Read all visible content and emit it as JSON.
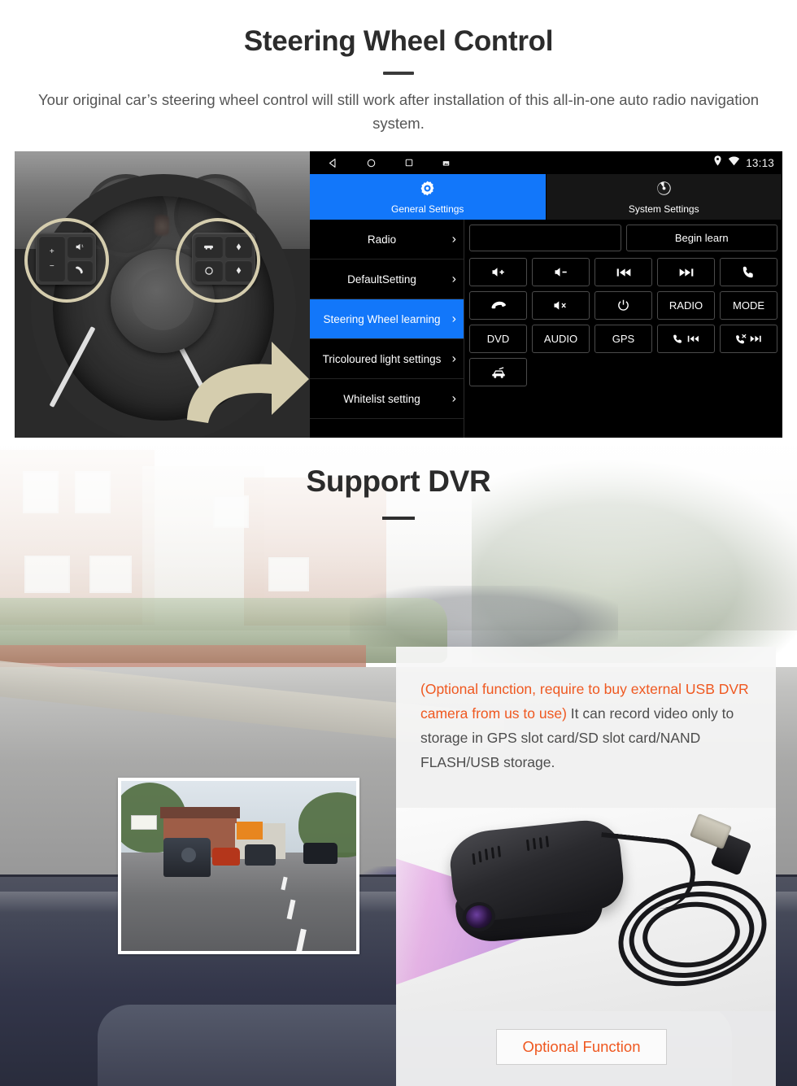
{
  "steering_section": {
    "title": "Steering Wheel Control",
    "subtitle": "Your original car’s steering wheel control will still work after installation of this all-in-one auto radio navigation system.",
    "head_unit": {
      "status_bar": {
        "nav_back_icon": "back-triangle-icon",
        "nav_home_icon": "home-circle-icon",
        "nav_recents_icon": "recents-square-icon",
        "screenshot_icon": "screenshot-icon",
        "location_icon": "location-pin-icon",
        "wifi_icon": "wifi-icon",
        "time": "13:13"
      },
      "tabs": [
        {
          "label": "General Settings",
          "icon": "gear-settings-icon",
          "active": true
        },
        {
          "label": "System Settings",
          "icon": "system-aperture-icon",
          "active": false
        }
      ],
      "menu_items": [
        {
          "label": "Radio",
          "selected": false
        },
        {
          "label": "DefaultSetting",
          "selected": false
        },
        {
          "label": "Steering Wheel learning",
          "selected": true
        },
        {
          "label": "Tricoloured light settings",
          "selected": false
        },
        {
          "label": "Whitelist setting",
          "selected": false
        }
      ],
      "chevron_glyph": "›",
      "learn_field_value": "",
      "begin_learn_label": "Begin learn",
      "keys": [
        {
          "label": "",
          "icon": "volume-up-icon",
          "name": "key-volume-up"
        },
        {
          "label": "",
          "icon": "volume-down-icon",
          "name": "key-volume-down"
        },
        {
          "label": "",
          "icon": "previous-track-icon",
          "name": "key-previous"
        },
        {
          "label": "",
          "icon": "next-track-icon",
          "name": "key-next"
        },
        {
          "label": "",
          "icon": "phone-answer-icon",
          "name": "key-answer-call"
        },
        {
          "label": "",
          "icon": "phone-hangup-icon",
          "name": "key-hangup-call"
        },
        {
          "label": "",
          "icon": "mute-icon",
          "name": "key-mute"
        },
        {
          "label": "",
          "icon": "power-icon",
          "name": "key-power"
        },
        {
          "label": "RADIO",
          "icon": "",
          "name": "key-radio"
        },
        {
          "label": "MODE",
          "icon": "",
          "name": "key-mode"
        },
        {
          "label": "DVD",
          "icon": "",
          "name": "key-dvd"
        },
        {
          "label": "AUDIO",
          "icon": "",
          "name": "key-audio"
        },
        {
          "label": "GPS",
          "icon": "",
          "name": "key-gps"
        },
        {
          "label": "",
          "icon": "phone-previous-icon",
          "name": "key-phone-previous"
        },
        {
          "label": "",
          "icon": "phone-reject-next-icon",
          "name": "key-phone-reject-next"
        },
        {
          "label": "",
          "icon": "car-icon",
          "name": "key-car"
        }
      ]
    },
    "photo_caption": "steering-wheel-photo"
  },
  "dvr_section": {
    "title": "Support DVR",
    "note_orange": "(Optional function, require to buy external USB DVR camera from us to use)",
    "note_body": "It can record video only to storage in GPS slot card/SD slot card/NAND FLASH/USB storage.",
    "optional_button_label": "Optional Function",
    "preview_name": "dvr-recording-preview",
    "product_name": "usb-dvr-camera-product-photo"
  },
  "colors": {
    "accent_blue": "#1277fa",
    "accent_orange": "#ef5820",
    "highlight_yellow": "#f7cf33",
    "title_dark": "#2b2b2b"
  }
}
